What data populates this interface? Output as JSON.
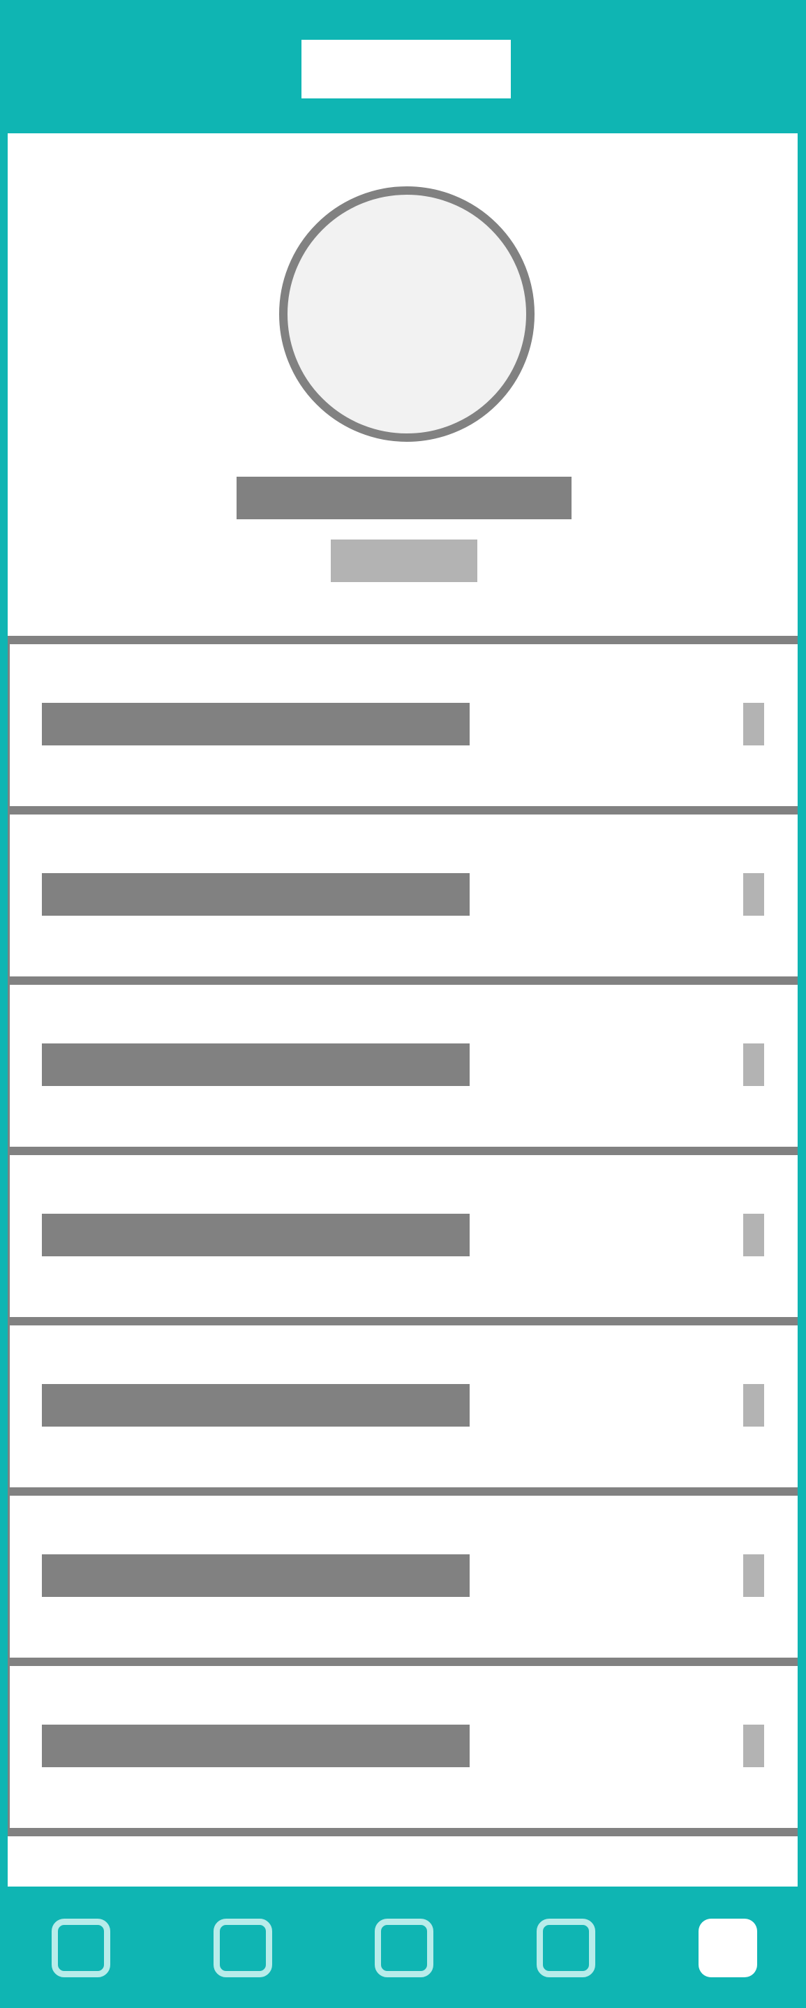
{
  "colors": {
    "brand": "#0fb5b3",
    "placeholder_dark": "#818181",
    "placeholder_light": "#b3b3b3",
    "avatar_fill": "#f2f2f2",
    "inactive_tab_outline": "#b8ecea",
    "surface": "#ffffff"
  },
  "header": {
    "title": ""
  },
  "profile": {
    "avatar_icon": "avatar-placeholder",
    "name": "",
    "subtitle": ""
  },
  "menu": {
    "items": [
      {
        "label": "",
        "icon": "chevron-right-icon"
      },
      {
        "label": "",
        "icon": "chevron-right-icon"
      },
      {
        "label": "",
        "icon": "chevron-right-icon"
      },
      {
        "label": "",
        "icon": "chevron-right-icon"
      },
      {
        "label": "",
        "icon": "chevron-right-icon"
      },
      {
        "label": "",
        "icon": "chevron-right-icon"
      },
      {
        "label": "",
        "icon": "chevron-right-icon"
      }
    ]
  },
  "bottom_nav": {
    "tabs": [
      {
        "icon": "tab-1-icon",
        "active": false
      },
      {
        "icon": "tab-2-icon",
        "active": false
      },
      {
        "icon": "tab-3-icon",
        "active": false
      },
      {
        "icon": "tab-4-icon",
        "active": false
      },
      {
        "icon": "tab-5-icon",
        "active": true
      }
    ]
  }
}
